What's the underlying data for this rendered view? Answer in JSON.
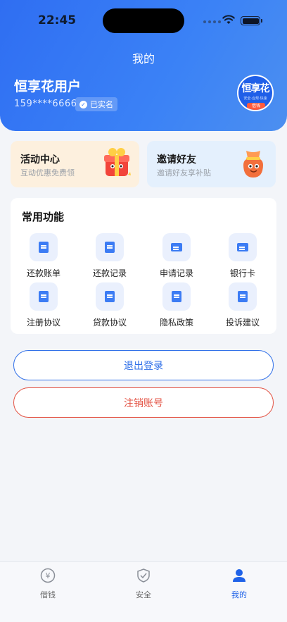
{
  "status_bar": {
    "time": "22:45"
  },
  "header": {
    "title": "我的"
  },
  "user": {
    "name": "恒享花用户",
    "phone": "159****6666",
    "verified_label": "已实名"
  },
  "logo": {
    "text_main": "恒享花",
    "text_sub": "安全·合规·快速",
    "text_tag": "借钱"
  },
  "promos": [
    {
      "title": "活动中心",
      "subtitle": "互动优惠免费领",
      "icon": "gift-box-icon"
    },
    {
      "title": "邀请好友",
      "subtitle": "邀请好友享补贴",
      "icon": "lucky-bag-icon"
    }
  ],
  "functions": {
    "title": "常用功能",
    "items": [
      {
        "label": "还款账单",
        "icon": "yuan-bill-icon"
      },
      {
        "label": "还款记录",
        "icon": "record-icon"
      },
      {
        "label": "申请记录",
        "icon": "application-icon"
      },
      {
        "label": "银行卡",
        "icon": "bank-card-icon"
      },
      {
        "label": "注册协议",
        "icon": "register-agreement-icon"
      },
      {
        "label": "贷款协议",
        "icon": "loan-agreement-icon"
      },
      {
        "label": "隐私政策",
        "icon": "privacy-icon"
      },
      {
        "label": "投诉建议",
        "icon": "complaint-icon"
      }
    ]
  },
  "buttons": {
    "logout": "退出登录",
    "cancel_account": "注销账号"
  },
  "tabbar": {
    "items": [
      {
        "label": "借钱",
        "icon": "yuan-circle-icon"
      },
      {
        "label": "安全",
        "icon": "shield-check-icon"
      },
      {
        "label": "我的",
        "icon": "person-icon",
        "active": true
      }
    ]
  },
  "colors": {
    "primary": "#2f6fe8",
    "danger": "#e35243",
    "activity_bg": "#fdf0de",
    "invite_bg": "#e4f0fd"
  }
}
